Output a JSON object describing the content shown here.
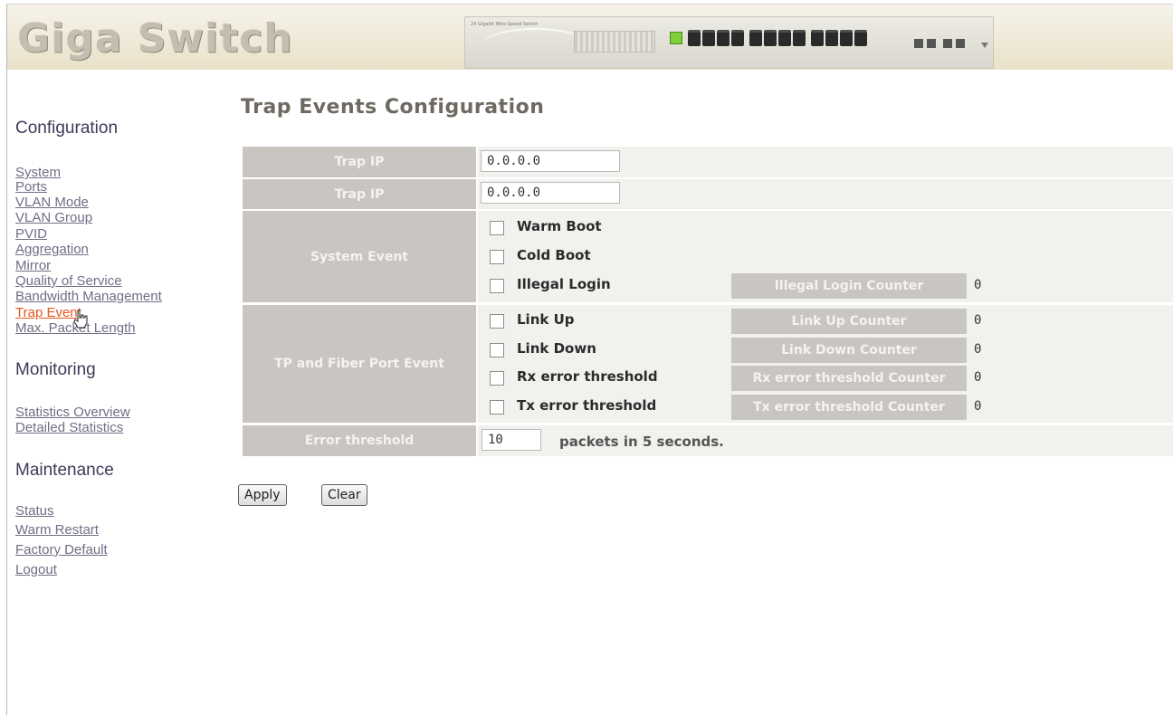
{
  "header": {
    "logo": "Giga Switch",
    "device_label": "24 Gigabit Wire-Speed Switch"
  },
  "sidebar": {
    "configuration_title": "Configuration",
    "configuration_items": [
      {
        "label": "System"
      },
      {
        "label": "Ports"
      },
      {
        "label": "VLAN Mode"
      },
      {
        "label": "VLAN Group"
      },
      {
        "label": "PVID"
      },
      {
        "label": "Aggregation"
      },
      {
        "label": "Mirror"
      },
      {
        "label": "Quality of Service"
      },
      {
        "label": "Bandwidth Management"
      },
      {
        "label": "Trap Event"
      },
      {
        "label": "Max. Packet Length"
      }
    ],
    "monitoring_title": "Monitoring",
    "monitoring_items": [
      {
        "label": "Statistics Overview"
      },
      {
        "label": "Detailed Statistics"
      }
    ],
    "maintenance_title": "Maintenance",
    "maintenance_items": [
      {
        "label": "Status"
      },
      {
        "label": "Warm Restart"
      },
      {
        "label": "Factory Default"
      },
      {
        "label": "Logout"
      }
    ],
    "active_item": "Trap Event"
  },
  "main": {
    "title": "Trap Events Configuration",
    "trap_ip_1": {
      "label": "Trap IP",
      "value": "0.0.0.0"
    },
    "trap_ip_2": {
      "label": "Trap IP",
      "value": "0.0.0.0"
    },
    "system_event": {
      "label": "System Event",
      "warm_boot": "Warm Boot",
      "cold_boot": "Cold Boot",
      "illegal_login": "Illegal Login",
      "illegal_login_counter_label": "Illegal Login Counter",
      "illegal_login_counter_value": "0"
    },
    "port_event": {
      "label": "TP and Fiber Port Event",
      "link_up": "Link Up",
      "link_up_counter_label": "Link Up Counter",
      "link_up_counter_value": "0",
      "link_down": "Link Down",
      "link_down_counter_label": "Link Down Counter",
      "link_down_counter_value": "0",
      "rx_error": "Rx error threshold",
      "rx_error_counter_label": "Rx error threshold Counter",
      "rx_error_counter_value": "0",
      "tx_error": "Tx error threshold",
      "tx_error_counter_label": "Tx error threshold Counter",
      "tx_error_counter_value": "0"
    },
    "error_threshold": {
      "label": "Error threshold",
      "value": "10",
      "suffix": "packets in 5 seconds."
    },
    "apply_label": "Apply",
    "clear_label": "Clear"
  },
  "colors": {
    "label_bg": "#c9c6c1",
    "active_link": "#e2571f",
    "link": "#6f6f86"
  }
}
